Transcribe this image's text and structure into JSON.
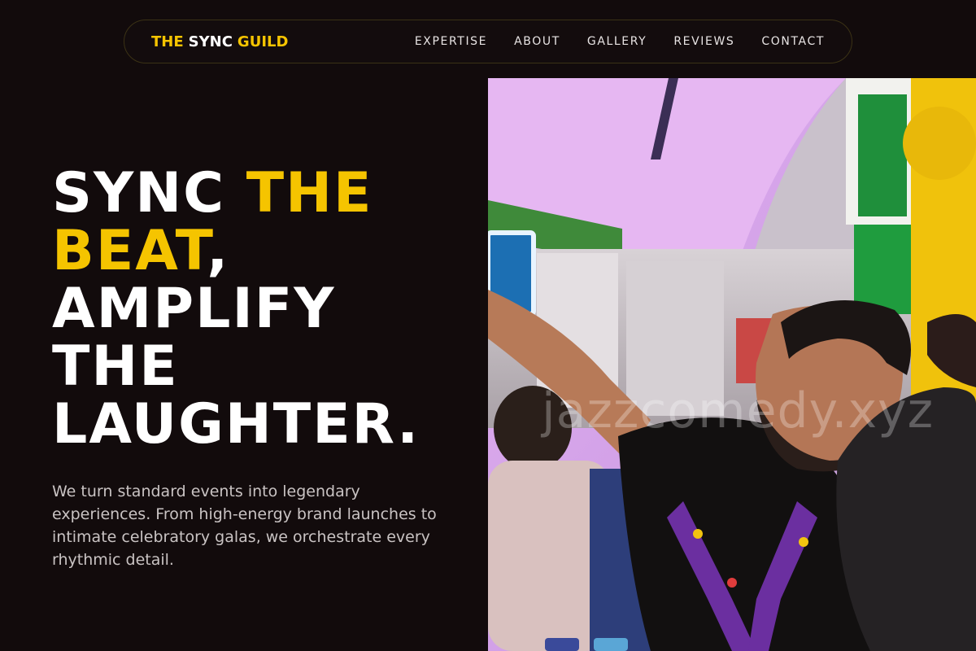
{
  "nav": {
    "brand_part1": "THE",
    "brand_part2": "SYNC",
    "brand_part3": "GUILD",
    "items": [
      {
        "label": "EXPERTISE"
      },
      {
        "label": "ABOUT"
      },
      {
        "label": "GALLERY"
      },
      {
        "label": "REVIEWS"
      },
      {
        "label": "CONTACT"
      }
    ]
  },
  "hero": {
    "title_w1": "SYNC",
    "title_w2": "THE",
    "title_w3": "BEAT",
    "title_comma": ",",
    "title_w4": "AMPLIFY",
    "title_w5": "THE",
    "title_w6": "LAUGHTER.",
    "description": "We turn standard events into legendary experiences. From high-energy brand launches to intimate celebratory galas, we orchestrate every rhythmic detail."
  },
  "photo": {
    "watermark": "jazzcomedy.xyz"
  },
  "colors": {
    "background": "#120b0c",
    "accent": "#f5c400",
    "text": "#ffffff"
  }
}
